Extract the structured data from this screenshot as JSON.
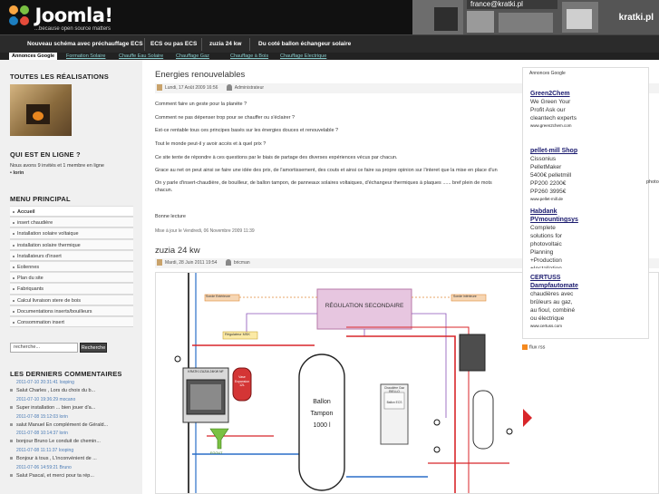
{
  "header": {
    "logo_name": "Joomla!",
    "logo_tagline": "...because open source matters",
    "ad_email": "france@kratki.pl",
    "ad_brand": "kratki.pl"
  },
  "nav": {
    "items": [
      "Nouveau schéma avec préchauffage ECS",
      "ECS ou pas ECS",
      "zuzia 24 kw",
      "Du coté ballon échangeur solaire"
    ]
  },
  "subnav": {
    "ads_label": "Annonces Google",
    "links": [
      "Formation Solaire",
      "Chauffe Eau Solaire",
      "Chauffage Gaz",
      "Chauffage à Bois",
      "Chauffage Electrique"
    ]
  },
  "sidebar": {
    "realisations_title": "TOUTES LES RÉALISATIONS",
    "online_title": "QUI EST EN LIGNE ?",
    "online_text": "Nous avons 9 invités et 1 membre en ligne",
    "online_member": "• Iorin",
    "menu_title": "MENU PRINCIPAL",
    "menu": [
      "Accueil",
      "insert chaudière",
      "Installation solaire voltaique",
      "installation solaire thermique",
      "Installateurs d'insert",
      "Eoliennes",
      "Plan du site",
      "Fabriquants",
      "Calcul livraison stere de bois",
      "Documentations inserts/bouilleurs",
      "Consommation insert"
    ],
    "search_placeholder": "recherche...",
    "search_button": "Recherche",
    "comments_title": "LES DERNIERS COMMENTAIRES",
    "comments": [
      {
        "date": "2011-07-10 20:31:41 Iooping",
        "text": "Salut Charles , Lors du choix du b..."
      },
      {
        "date": "2011-07-10 19:36:29 mocano",
        "text": "Super installation ... bien jouer d'a..."
      },
      {
        "date": "2011-07-08 15:12:03 lorin",
        "text": "salut Manuel En complément de Gérald..."
      },
      {
        "date": "2011-07-08 10:14:37 lorin",
        "text": "bonjour Bruno Le conduit de chemin..."
      },
      {
        "date": "2011-07-08 11:11:37 Iooping",
        "text": "Bonjour à tous , L'inconvénient de ..."
      },
      {
        "date": "2011-07-06 14:59:21 Bruno",
        "text": "Salut Pascal, et merci pour ta rép..."
      }
    ]
  },
  "article1": {
    "title": "Energies renouvelables",
    "date": "Lundi, 17 Août 2009 16:56",
    "author": "Administrateur",
    "paragraphs": [
      "Comment faire un geste pour la planète ?",
      "Comment ne pas dépenser trop pour se chauffer ou s'éclairer ?",
      "Est-ce rentable tous ces principes basés sur les énergies douces et renouvelable ?",
      "Tout le monde peut-il y avoir accès et à quel prix ?",
      "Ce site tente de répondre à ces questions par le biais de partage des diverses expériences vécus par chacun.",
      "Grace au net on peut ainsi se faire une idée des prix, de l'amortissement, des couts et ainsi ce faire sa propre opinion sur l'interet que la mise en place d'un",
      "On y parle d'insert-chaudière, de bouilleur, de ballon tampon, de panneaux solaires voltaiques, d'échangeur thermiques à plaques ...... bref plein de mots",
      "chacun.",
      "Bonne lecture"
    ],
    "photo_word": "photo",
    "updated": "Mise à jour le Vendredi, 06 Novembre 2009 11:39"
  },
  "article2": {
    "title": "zuzia 24 kw",
    "date": "Mardi, 28 Juin 2011 19:54",
    "author": "bricman",
    "diagram": {
      "regulation": "RÉGULATION SECONDAIRE",
      "sonde_ext": "Sonde Extérieure",
      "sonde_int": "Sonde intérieure",
      "regulateur": "Régulateur MSK",
      "insert": "KRATKI ZUZIA 24KW NF",
      "vase": "Vase Expansion 12L",
      "egout": "EGOUT",
      "ballon_label": "Ballon",
      "ballon_label2": "Tampon",
      "ballon_label3": "1000 l",
      "chaudiere": "Chaudière Gaz RIELLO",
      "ballon_ecs": "Ballon ECS"
    }
  },
  "ads": {
    "label": "Annonces Google",
    "items": [
      {
        "title": "Green2Chem",
        "body": [
          "We Green Your",
          "Profit Ask our",
          "cleantech experts"
        ],
        "url": "www.green2chem.com"
      },
      {
        "title": "pellet-mill Shop",
        "body": [
          "Cissonius",
          "PelletMaker",
          "5400€ pelletmill",
          "PP200 2200€",
          "PP260 3995€"
        ],
        "url": "www.pellet-mill.de"
      },
      {
        "title": "Habdank",
        "title2": "PVmountingsys",
        "body": [
          "Complete",
          "solutions for",
          "photovoltaic",
          "Planning",
          "+Production",
          "+Installation"
        ],
        "url": ""
      },
      {
        "title": "CERTUSS",
        "title2": "Dampfautomate",
        "body": [
          "chaudières avec",
          "brûleurs au gaz,",
          "au fioul, combiné",
          "ou électrique"
        ],
        "url": "www.certuss.com"
      }
    ],
    "rss": "flux rss"
  }
}
